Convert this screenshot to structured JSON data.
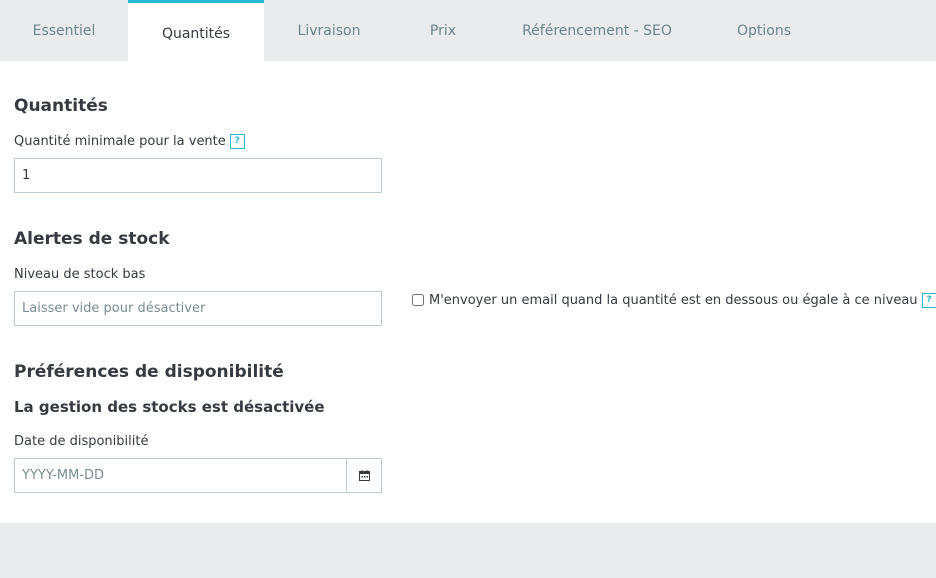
{
  "tabs": [
    {
      "label": "Essentiel"
    },
    {
      "label": "Quantités"
    },
    {
      "label": "Livraison"
    },
    {
      "label": "Prix"
    },
    {
      "label": "Référencement - SEO"
    },
    {
      "label": "Options"
    }
  ],
  "active_tab": "Quantités",
  "quantities": {
    "heading": "Quantités",
    "min_qty_label": "Quantité minimale pour la vente",
    "min_qty_value": "1",
    "help_glyph": "?"
  },
  "stock_alerts": {
    "heading": "Alertes de stock",
    "low_stock_label": "Niveau de stock bas",
    "low_stock_placeholder": "Laisser vide pour désactiver",
    "email_checkbox_label": "M'envoyer un email quand la quantité est en dessous ou égale à ce niveau",
    "email_checked": false,
    "help_glyph": "?"
  },
  "availability": {
    "heading": "Préférences de disponibilité",
    "subheading": "La gestion des stocks est désactivée",
    "date_label": "Date de disponibilité",
    "date_placeholder": "YYYY-MM-DD"
  },
  "colors": {
    "accent": "#25b9d7",
    "border": "#bbcdd2",
    "background": "#eaebec"
  },
  "icons": {
    "help": "question-icon",
    "calendar": "calendar-icon"
  }
}
